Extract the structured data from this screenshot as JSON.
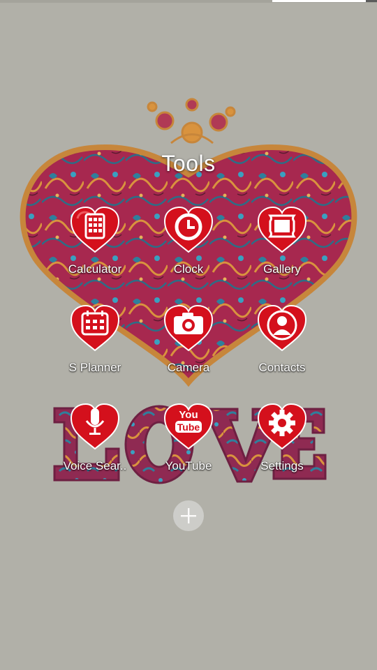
{
  "folder": {
    "title": "Tools"
  },
  "apps": [
    {
      "label": "Calculator",
      "icon": "calculator-icon"
    },
    {
      "label": "Clock",
      "icon": "clock-icon"
    },
    {
      "label": "Gallery",
      "icon": "gallery-icon"
    },
    {
      "label": "S Planner",
      "icon": "calendar-icon"
    },
    {
      "label": "Camera",
      "icon": "camera-icon"
    },
    {
      "label": "Contacts",
      "icon": "contacts-icon"
    },
    {
      "label": "Voice Sear..",
      "icon": "microphone-icon"
    },
    {
      "label": "YouTube",
      "icon": "youtube-icon",
      "icon_text_top": "You",
      "icon_text_bottom": "Tube"
    },
    {
      "label": "Settings",
      "icon": "gear-icon"
    }
  ],
  "wallpaper": {
    "word": "LOVE"
  },
  "colors": {
    "background": "#b1b0a8",
    "heart_fill": "#a7284f",
    "heart_outline": "#c7863b",
    "icon_red": "#d4101c",
    "label_text": "#ffffff"
  },
  "add_button": {
    "icon": "plus-icon"
  }
}
